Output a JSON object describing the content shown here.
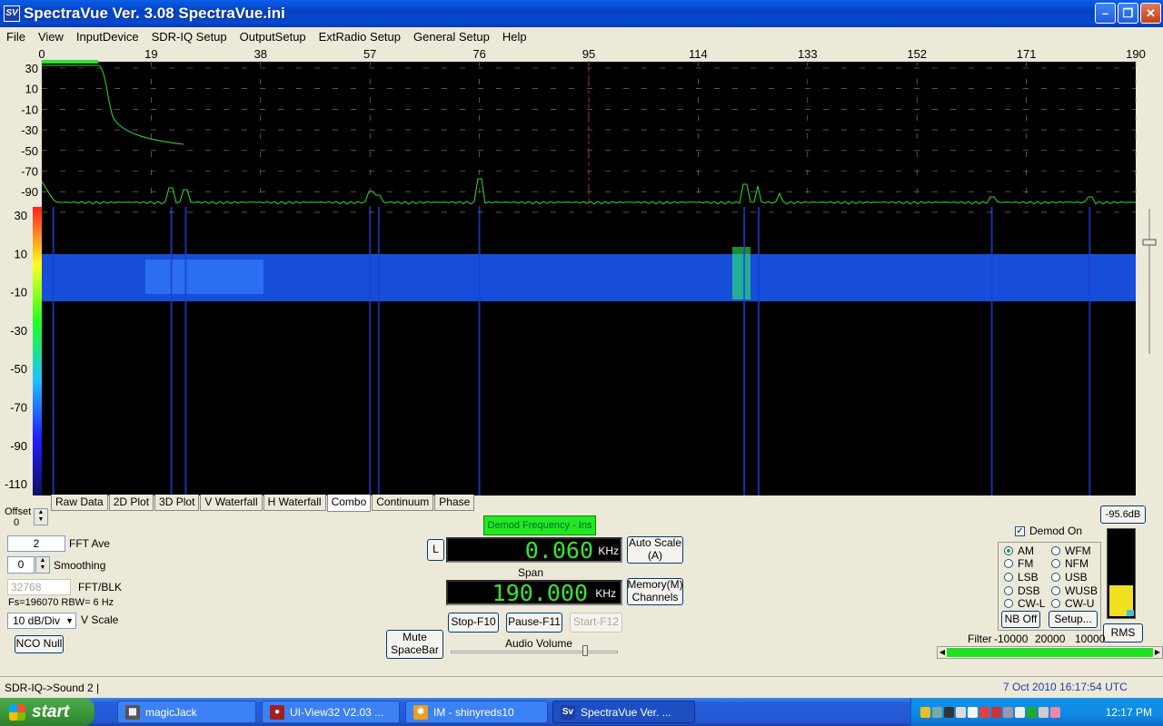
{
  "window": {
    "title": "SpectraVue Ver. 3.08 SpectraVue.ini",
    "icon_text": "SV",
    "minimize_icon": "minimize-icon",
    "maximize_icon": "restore-icon",
    "close_icon": "close-icon"
  },
  "menu": [
    "File",
    "View",
    "InputDevice",
    "SDR-IQ Setup",
    "OutputSetup",
    "ExtRadio Setup",
    "General Setup",
    "Help"
  ],
  "display": {
    "freq_ticks": [
      "0",
      "19",
      "38",
      "57",
      "76",
      "95",
      "114",
      "133",
      "152",
      "171",
      "190"
    ],
    "spectrum_db_labels": [
      "30",
      "10",
      "-10",
      "-30",
      "-50",
      "-70",
      "-90"
    ],
    "waterfall_db_labels": [
      "30",
      "10",
      "-10",
      "-30",
      "-50",
      "-70",
      "-90",
      "-110"
    ],
    "trace_color": "#33dd33",
    "center_marker_color": "#cc2222",
    "waterfall_color": "#1a5cff"
  },
  "tabs": [
    "Raw Data",
    "2D Plot",
    "3D Plot",
    "V Waterfall",
    "H Waterfall",
    "Combo",
    "Continuum",
    "Phase"
  ],
  "active_tab": "Combo",
  "controls": {
    "offset_label": "Offset",
    "offset_value": "0",
    "fft_ave_value": "2",
    "fft_ave_label": "FFT Ave",
    "smoothing_value": "0",
    "smoothing_label": "Smoothing",
    "fft_blk_value": "32768",
    "fft_blk_label": "FFT/BLK",
    "fs_info": "Fs=196070 RBW=   6 Hz",
    "vscale_value": "10 dB/Div",
    "vscale_label": "V Scale",
    "nco_null": "NCO Null"
  },
  "demod": {
    "banner": "Demod Frequency - Ins",
    "l_button": "L",
    "freq_value": "0.060",
    "freq_unit": "KHz",
    "auto_scale": "Auto Scale\n(A)",
    "span_label": "Span",
    "span_value": "190.000",
    "span_unit": "KHz",
    "memory": "Memory(M)\nChannels",
    "mute": "Mute\nSpaceBar",
    "stop": "Stop-F10",
    "pause": "Pause-F11",
    "start": "Start-F12",
    "audio_volume": "Audio Volume"
  },
  "mode_panel": {
    "demod_on": "Demod On",
    "db_readout": "-95.6dB",
    "modes_left": [
      "AM",
      "FM",
      "LSB",
      "DSB",
      "CW-L"
    ],
    "modes_right": [
      "WFM",
      "NFM",
      "USB",
      "WUSB",
      "CW-U"
    ],
    "selected": "AM",
    "nb_off": "NB Off",
    "setup": "Setup...",
    "rms": "RMS",
    "filter_label": "Filter",
    "filter_values": [
      "-10000",
      "20000",
      "10000"
    ]
  },
  "status": {
    "left": "SDR-IQ->Sound 2  |",
    "datetime": "7 Oct 2010  16:17:54 UTC"
  },
  "taskbar": {
    "start": "start",
    "tasks": [
      "magicJack",
      "UI-View32 V2.03 ...",
      "IM - shinyreds10",
      "SpectraVue Ver. ..."
    ],
    "clock": "12:17 PM"
  }
}
